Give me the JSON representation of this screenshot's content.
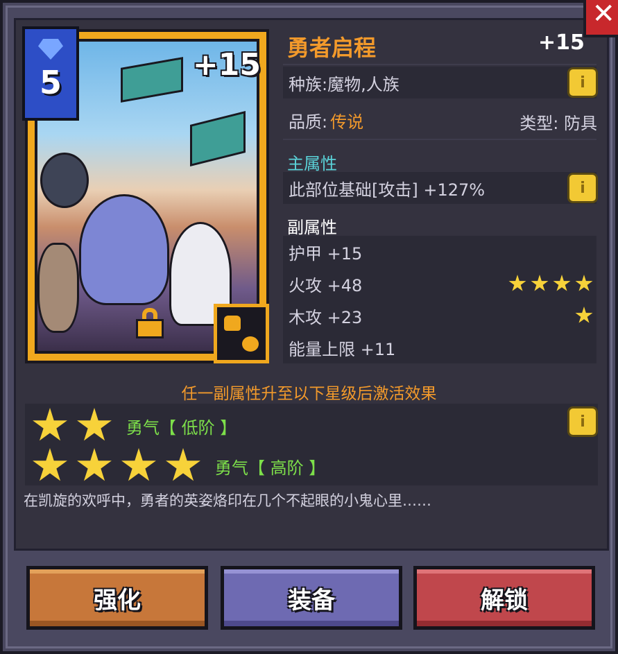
{
  "card": {
    "cost": "5",
    "level": "+15"
  },
  "equipment": {
    "name": "勇者启程",
    "level": "+15"
  },
  "race": "种族:魔物,人族",
  "quality": {
    "label": "品质:",
    "value": "传说"
  },
  "type": "类型:  防具",
  "main_stat": {
    "header": "主属性",
    "text": "此部位基础[攻击] +127%"
  },
  "sub_stats": {
    "header": "副属性",
    "items": [
      {
        "text": "护甲 +15",
        "stars": 0
      },
      {
        "text": "火攻 +48",
        "stars": 4
      },
      {
        "text": "木攻 +23",
        "stars": 1
      },
      {
        "text": "能量上限 +11",
        "stars": 0
      }
    ]
  },
  "set_bonus": {
    "header": "任一副属性升至以下星级后激活效果",
    "tiers": [
      {
        "stars": 2,
        "text": "勇气【 低阶 】"
      },
      {
        "stars": 4,
        "text": "勇气【 高阶 】"
      }
    ]
  },
  "description": "在凯旋的欢呼中，勇者的英姿烙印在几个不起眼的小鬼心里……",
  "buttons": {
    "upgrade": "强化",
    "equip": "装备",
    "unlock": "解锁"
  },
  "icons": {
    "close": "close-icon",
    "info": "info-icon",
    "lock": "lock-icon",
    "gem": "gem-icon",
    "race": "race-icon",
    "star": "star-icon"
  },
  "colors": {
    "accent": "#f39a2b",
    "cyan": "#5ad2d8",
    "green": "#7ddf4a",
    "star": "#f7d23a"
  }
}
